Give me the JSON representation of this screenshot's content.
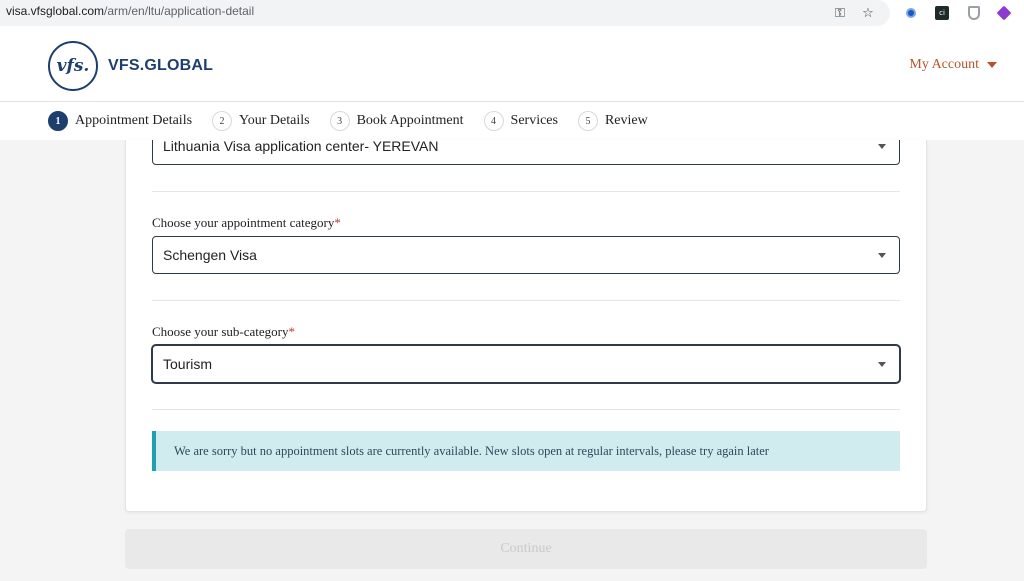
{
  "browser": {
    "url_host": "visa.vfsglobal.com",
    "url_path": "/arm/en/ltu/application-detail",
    "icons": [
      "key-icon",
      "star-icon",
      "extension-icon",
      "extension-ci-icon",
      "extension-shield-icon",
      "extension-cube-icon"
    ]
  },
  "header": {
    "logo_mark": "vfs.",
    "logo_text": "VFS.GLOBAL",
    "account_label": "My Account",
    "brand_color": "#1c3f6e",
    "accent_color": "#b5542c"
  },
  "stepper": {
    "steps": [
      {
        "num": "1",
        "label": "Appointment Details",
        "active": true
      },
      {
        "num": "2",
        "label": "Your Details",
        "active": false
      },
      {
        "num": "3",
        "label": "Book Appointment",
        "active": false
      },
      {
        "num": "4",
        "label": "Services",
        "active": false
      },
      {
        "num": "5",
        "label": "Review",
        "active": false
      }
    ]
  },
  "form": {
    "centre_value": "Lithuania Visa application center- YEREVAN",
    "category_label": "Choose your appointment category",
    "category_value": "Schengen Visa",
    "subcategory_label": "Choose your sub-category",
    "subcategory_value": "Tourism",
    "required_marker": "*"
  },
  "alert": {
    "message": "We are sorry but no appointment slots are currently available. New slots open at regular intervals, please try again later",
    "color": "#d1ecef"
  },
  "continue_label": "Continue"
}
